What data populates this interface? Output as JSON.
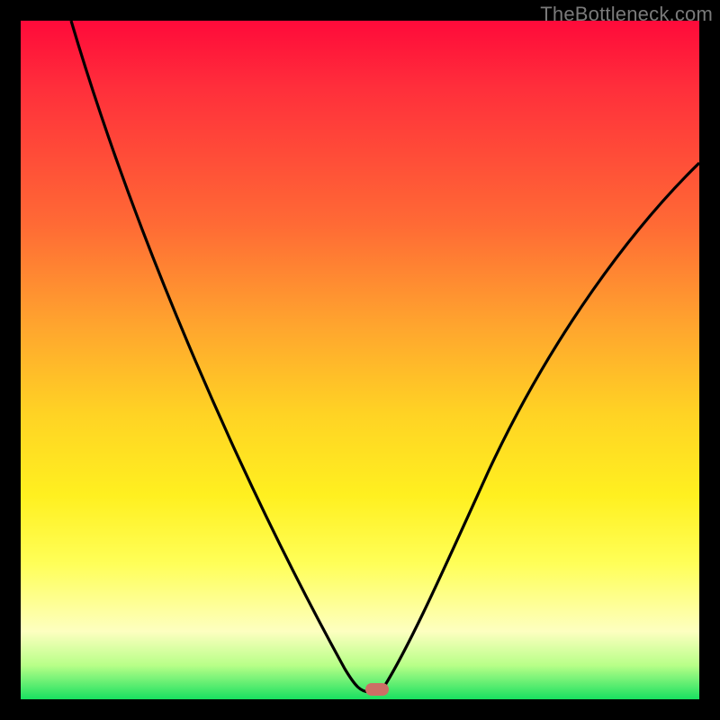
{
  "watermark": "TheBottleneck.com",
  "marker": {
    "x_frac": 0.525,
    "y_frac": 0.985
  },
  "chart_data": {
    "type": "line",
    "title": "",
    "xlabel": "",
    "ylabel": "",
    "xlim": [
      0,
      1
    ],
    "ylim": [
      0,
      1
    ],
    "x": [
      0.0,
      0.05,
      0.1,
      0.15,
      0.2,
      0.25,
      0.3,
      0.35,
      0.4,
      0.45,
      0.48,
      0.5,
      0.515,
      0.53,
      0.56,
      0.6,
      0.65,
      0.7,
      0.75,
      0.8,
      0.85,
      0.9,
      0.95,
      1.0
    ],
    "values": [
      1.0,
      0.92,
      0.835,
      0.745,
      0.655,
      0.56,
      0.47,
      0.375,
      0.28,
      0.17,
      0.09,
      0.035,
      0.01,
      0.015,
      0.06,
      0.15,
      0.28,
      0.4,
      0.5,
      0.585,
      0.66,
      0.72,
      0.77,
      0.81
    ],
    "grid": false,
    "legend": false,
    "annotations": [
      {
        "type": "marker",
        "x": 0.525,
        "y": 0.015
      }
    ],
    "background_gradient": {
      "top": "#ff0a3a",
      "bottom": "#18e060"
    }
  }
}
